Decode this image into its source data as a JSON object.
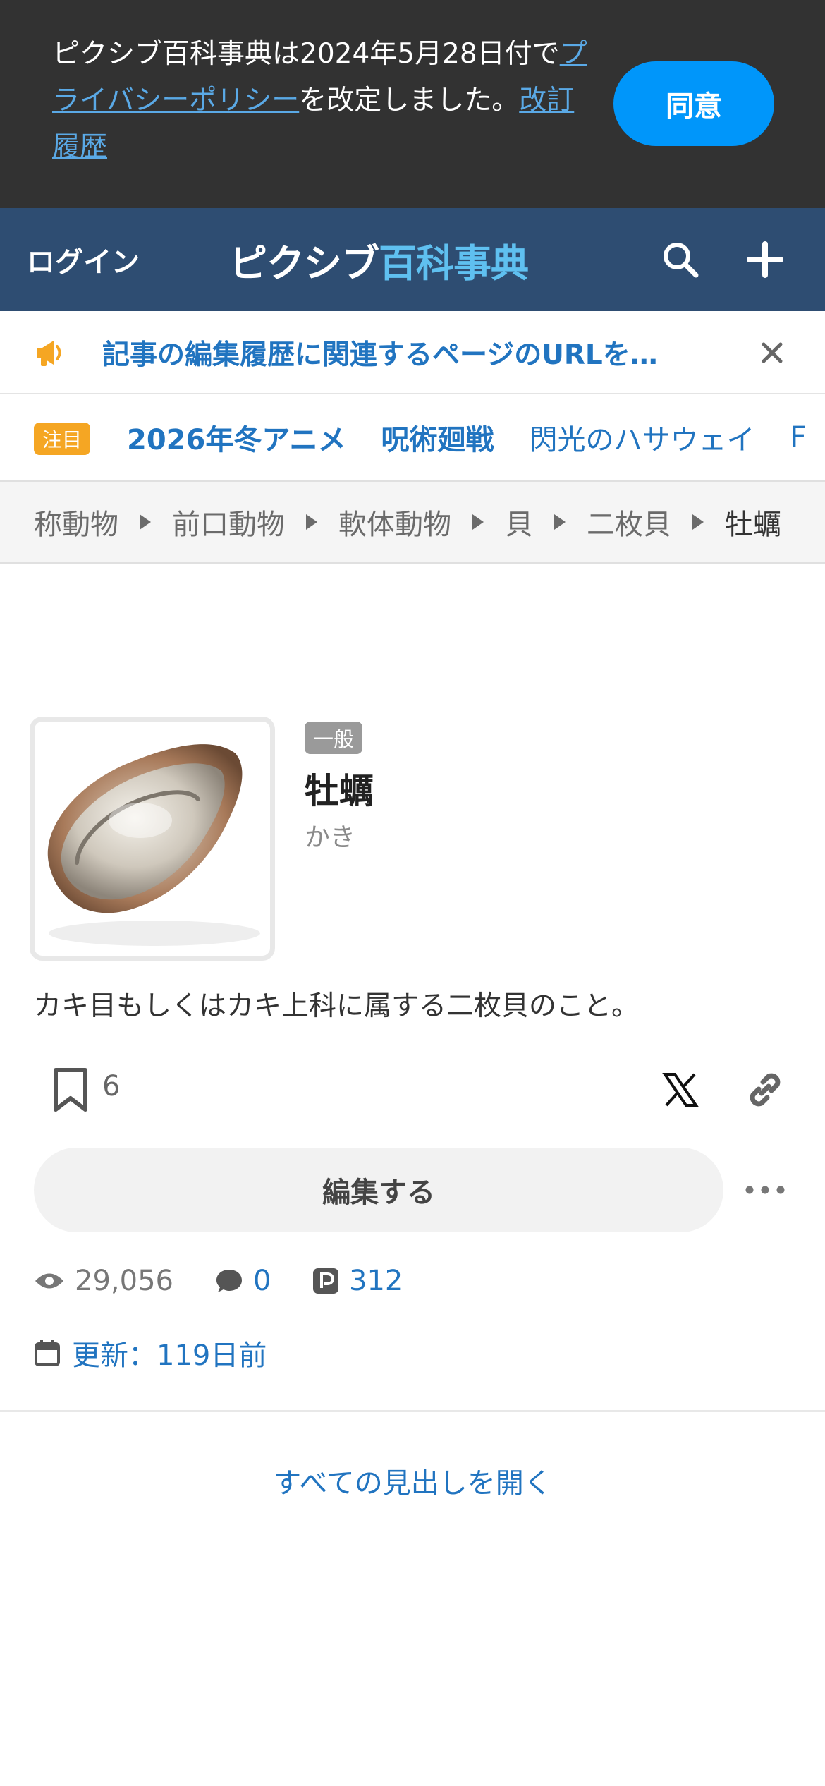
{
  "consent": {
    "text_1": "ピクシブ百科事典は2024年5月28日付で",
    "link_policy": "プライバシーポリシー",
    "text_2": "を改定しました。",
    "link_history": "改訂履歴",
    "agree_label": "同意"
  },
  "header": {
    "login_label": "ログイン",
    "logo_part1": "ピクシブ",
    "logo_part2": "百科事典",
    "icons": [
      "search-icon",
      "plus-icon"
    ]
  },
  "notice": {
    "text": "記事の編集履歴に関連するページのURLを…",
    "icon": "megaphone-icon",
    "close_icon": "close-icon",
    "icon_color": "#f5a623"
  },
  "trending": {
    "badge": "注目",
    "items": [
      "2026年冬アニメ",
      "呪術廻戦",
      "閃光のハサウェイ",
      "F"
    ]
  },
  "breadcrumb": [
    "称動物",
    "前口動物",
    "軟体動物",
    "貝",
    "二枚貝",
    "牡蠣"
  ],
  "article": {
    "tag": "一般",
    "title": "牡蠣",
    "reading": "かき",
    "summary": "カキ目もしくはカキ上科に属する二枚貝のこと。",
    "bookmark_count": "6",
    "edit_label": "編集する",
    "views": "29,056",
    "comments": "0",
    "pixiv_count": "312",
    "updated": "更新：119日前"
  },
  "footer_link": "すべての見出しを開く",
  "colors": {
    "header_bg": "#2e4d72",
    "link_blue": "#2174c0",
    "agree_blue": "#0096fa",
    "banner_bg": "#323232"
  }
}
